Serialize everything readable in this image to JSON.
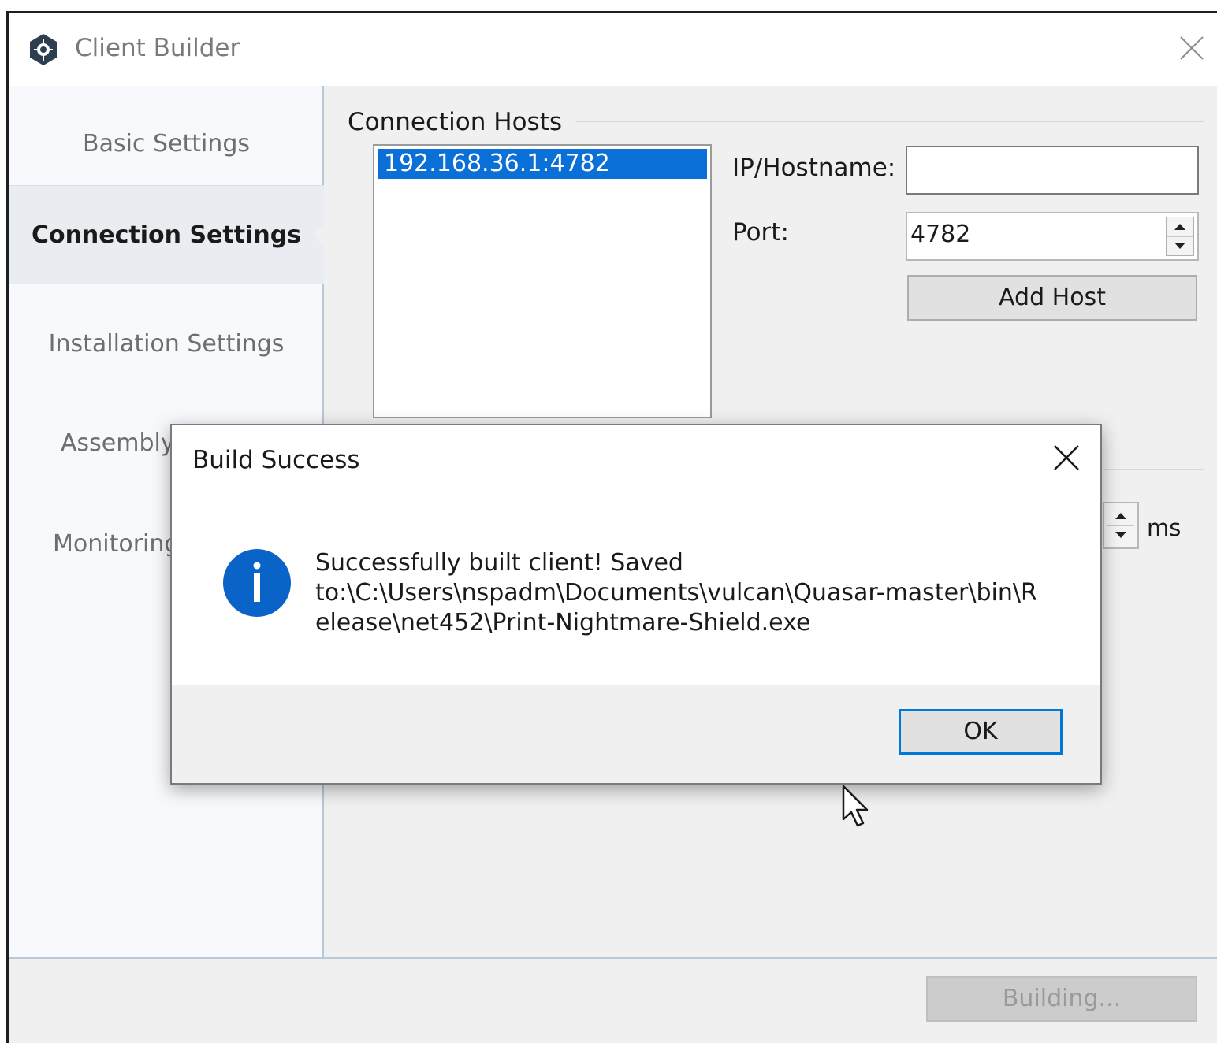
{
  "window": {
    "title": "Client Builder",
    "app_icon": "quasar-logo-icon",
    "close_icon": "close-icon"
  },
  "sidebar": {
    "items": [
      {
        "label": "Basic Settings",
        "active": false
      },
      {
        "label": "Connection Settings",
        "active": true
      },
      {
        "label": "Installation Settings",
        "active": false
      },
      {
        "label": "Assembly",
        "active": false
      },
      {
        "label": "Monitoring",
        "active": false
      }
    ]
  },
  "connection": {
    "group_title": "Connection Hosts",
    "hosts": [
      "192.168.36.1:4782"
    ],
    "ip_label": "IP/Hostname:",
    "ip_value": "",
    "port_label": "Port:",
    "port_value": "4782",
    "add_host_label": "Add Host",
    "delay_unit": "ms"
  },
  "footer": {
    "build_button_label": "Building..."
  },
  "dialog": {
    "title": "Build Success",
    "icon": "info-icon",
    "message_line1": "Successfully built client! Saved",
    "message_line2": "to:\\C:\\Users\\nspadm\\Documents\\vulcan\\Quasar-master\\bin\\R",
    "message_line3": "elease\\net452\\Print-Nightmare-Shield.exe",
    "ok_label": "OK"
  },
  "colors": {
    "selection": "#0a6fd6",
    "info_blue": "#0a64c8",
    "ok_border": "#0078d7"
  }
}
